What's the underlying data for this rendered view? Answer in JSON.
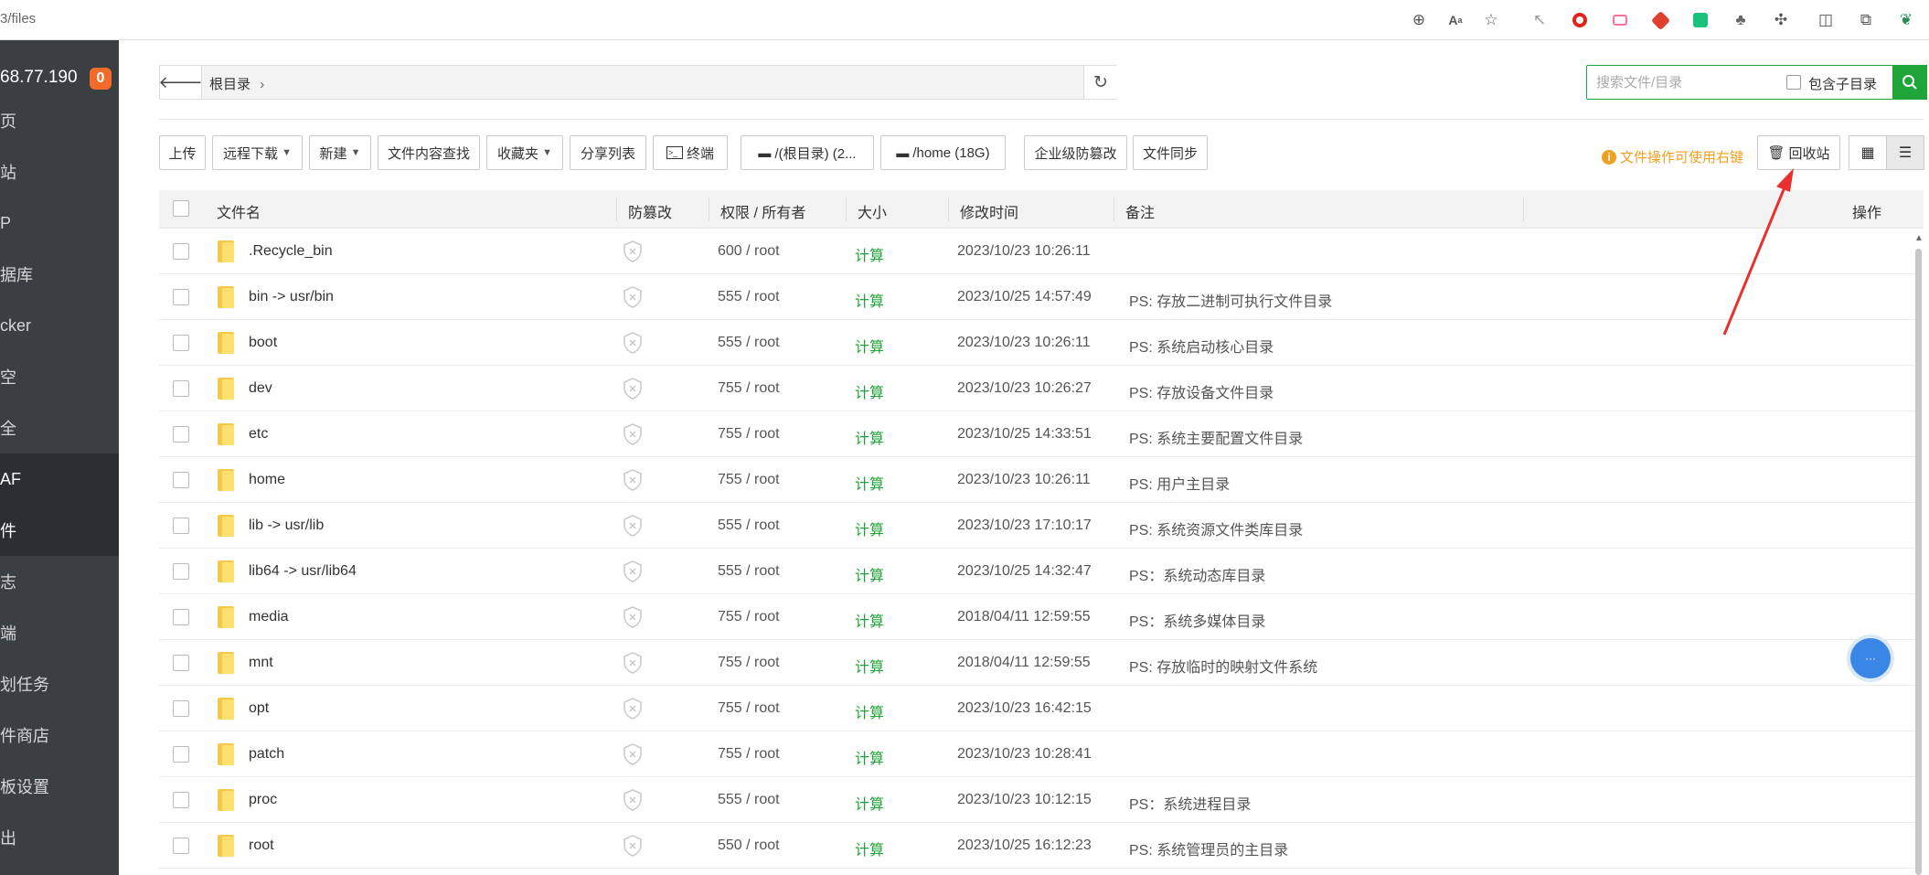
{
  "browser": {
    "url": "3/files",
    "icons": [
      "zoom-icon",
      "read-aloud-icon",
      "favorite-star-icon",
      "cursor-icon",
      "opera-icon",
      "bilibili-icon",
      "dice-icon",
      "chatgpt-icon",
      "extension-icon",
      "puzzle-icon",
      "split-screen-icon",
      "collections-icon",
      "extensions-menu-icon"
    ]
  },
  "sidebar": {
    "ip": "68.77.190",
    "badge": "0",
    "items": [
      {
        "label": "页"
      },
      {
        "label": "站"
      },
      {
        "label": "P"
      },
      {
        "label": "据库"
      },
      {
        "label": "cker"
      },
      {
        "label": "空"
      },
      {
        "label": "全"
      },
      {
        "label": "AF"
      },
      {
        "label": "件"
      },
      {
        "label": "志"
      },
      {
        "label": "端"
      },
      {
        "label": "划任务"
      },
      {
        "label": "件商店"
      },
      {
        "label": "板设置"
      },
      {
        "label": "出"
      }
    ]
  },
  "path": {
    "root_label": "根目录",
    "separator": "›"
  },
  "search": {
    "placeholder": "搜索文件/目录",
    "include_sub_label": "包含子目录"
  },
  "toolbar": {
    "upload": "上传",
    "remote_download": "远程下载",
    "new": "新建",
    "content_search": "文件内容查找",
    "favorites": "收藏夹",
    "share_list": "分享列表",
    "terminal": "终端",
    "disk_root": "/(根目录) (2...",
    "disk_home": "/home (18G)",
    "tamper_proof": "企业级防篡改",
    "file_sync": "文件同步",
    "hint": "文件操作可使用右键",
    "recycle_bin": "回收站"
  },
  "table": {
    "headers": {
      "name": "文件名",
      "tamper": "防篡改",
      "perm": "权限 / 所有者",
      "size": "大小",
      "mtime": "修改时间",
      "note": "备注",
      "ops": "操作"
    },
    "rows": [
      {
        "name": ".Recycle_bin",
        "perm": "600 / root",
        "size": "计算",
        "mtime": "2023/10/23 10:26:11",
        "note": ""
      },
      {
        "name": "bin -> usr/bin",
        "perm": "555 / root",
        "size": "计算",
        "mtime": "2023/10/25 14:57:49",
        "note": "PS: 存放二进制可执行文件目录"
      },
      {
        "name": "boot",
        "perm": "555 / root",
        "size": "计算",
        "mtime": "2023/10/23 10:26:11",
        "note": "PS: 系统启动核心目录"
      },
      {
        "name": "dev",
        "perm": "755 / root",
        "size": "计算",
        "mtime": "2023/10/23 10:26:27",
        "note": "PS: 存放设备文件目录"
      },
      {
        "name": "etc",
        "perm": "755 / root",
        "size": "计算",
        "mtime": "2023/10/25 14:33:51",
        "note": "PS: 系统主要配置文件目录"
      },
      {
        "name": "home",
        "perm": "755 / root",
        "size": "计算",
        "mtime": "2023/10/23 10:26:11",
        "note": "PS: 用户主目录"
      },
      {
        "name": "lib -> usr/lib",
        "perm": "555 / root",
        "size": "计算",
        "mtime": "2023/10/23 17:10:17",
        "note": "PS: 系统资源文件类库目录"
      },
      {
        "name": "lib64 -> usr/lib64",
        "perm": "555 / root",
        "size": "计算",
        "mtime": "2023/10/25 14:32:47",
        "note": "PS：系统动态库目录"
      },
      {
        "name": "media",
        "perm": "755 / root",
        "size": "计算",
        "mtime": "2018/04/11 12:59:55",
        "note": "PS：系统多媒体目录"
      },
      {
        "name": "mnt",
        "perm": "755 / root",
        "size": "计算",
        "mtime": "2018/04/11 12:59:55",
        "note": "PS: 存放临时的映射文件系统"
      },
      {
        "name": "opt",
        "perm": "755 / root",
        "size": "计算",
        "mtime": "2023/10/23 16:42:15",
        "note": ""
      },
      {
        "name": "patch",
        "perm": "755 / root",
        "size": "计算",
        "mtime": "2023/10/23 10:28:41",
        "note": ""
      },
      {
        "name": "proc",
        "perm": "555 / root",
        "size": "计算",
        "mtime": "2023/10/23 10:12:15",
        "note": "PS：系统进程目录"
      },
      {
        "name": "root",
        "perm": "550 / root",
        "size": "计算",
        "mtime": "2023/10/25 16:12:23",
        "note": "PS: 系统管理员的主目录"
      }
    ]
  },
  "colors": {
    "accent_green": "#20a53a",
    "sidebar_bg": "#3a3f44",
    "hint_orange": "#f0a020",
    "annotation_red": "#e8312f",
    "badge_orange": "#f26b2a"
  }
}
